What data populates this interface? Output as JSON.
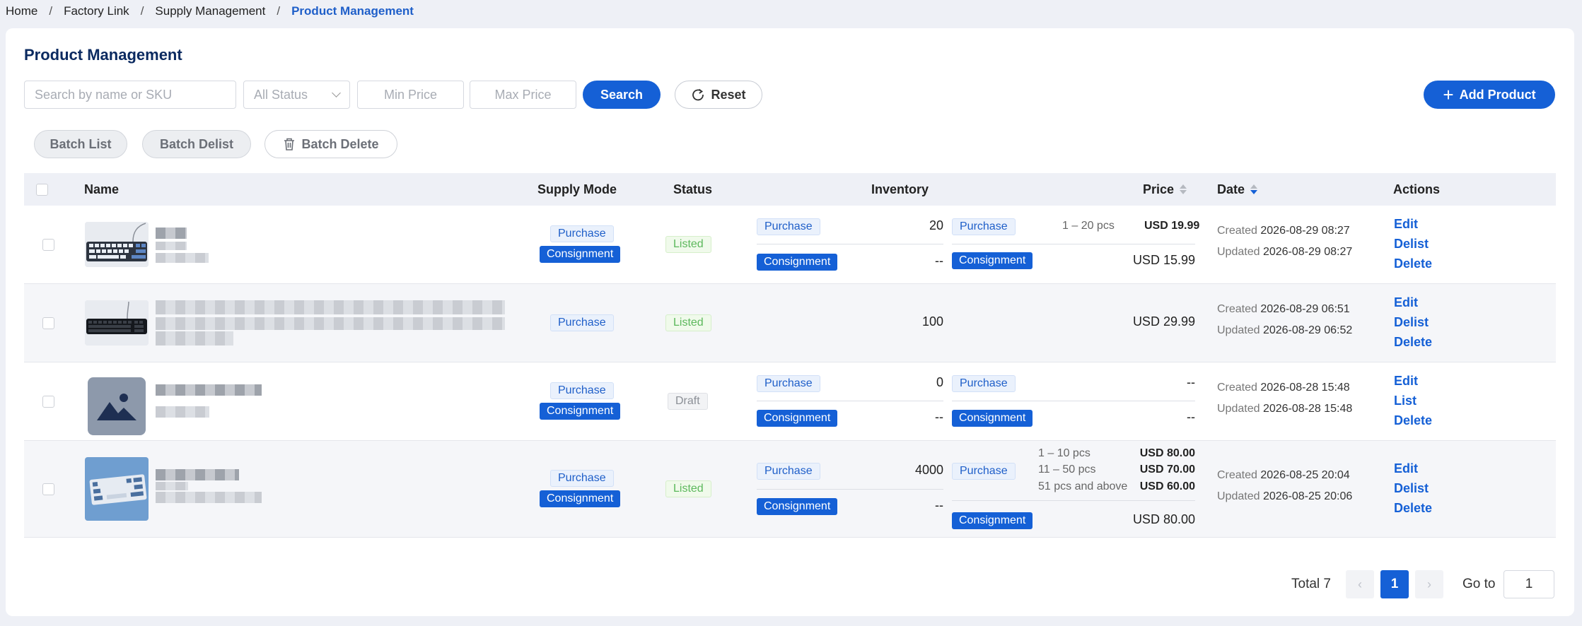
{
  "breadcrumb": [
    "Home",
    "Factory Link",
    "Supply Management",
    "Product Management"
  ],
  "page_title": "Product Management",
  "filters": {
    "search_placeholder": "Search by name or SKU",
    "status_placeholder": "All Status",
    "min_price_placeholder": "Min Price",
    "max_price_placeholder": "Max Price",
    "search_label": "Search",
    "reset_label": "Reset",
    "add_label": "Add Product"
  },
  "batch": {
    "list": "Batch List",
    "delist": "Batch Delist",
    "delete": "Batch Delete"
  },
  "columns": {
    "name": "Name",
    "supply_mode": "Supply Mode",
    "status": "Status",
    "inventory": "Inventory",
    "price": "Price",
    "date": "Date",
    "actions": "Actions"
  },
  "labels": {
    "purchase": "Purchase",
    "consignment": "Consignment",
    "created": "Created",
    "updated": "Updated",
    "edit": "Edit",
    "delete": "Delete"
  },
  "rows": [
    {
      "status": "Listed",
      "inv_purchase": "20",
      "inv_consignment": "--",
      "price_tier": "1 – 20 pcs",
      "price_tier_value": "USD 19.99",
      "price_consignment": "USD 15.99",
      "created": "2026-08-29 08:27",
      "updated": "2026-08-29 08:27",
      "toggle_action": "Delist"
    },
    {
      "status": "Listed",
      "inventory": "100",
      "price": "USD 29.99",
      "created": "2026-08-29 06:51",
      "updated": "2026-08-29 06:52",
      "toggle_action": "Delist"
    },
    {
      "status": "Draft",
      "inv_purchase": "0",
      "inv_consignment": "--",
      "price_purchase": "--",
      "price_consignment": "--",
      "created": "2026-08-28 15:48",
      "updated": "2026-08-28 15:48",
      "toggle_action": "List"
    },
    {
      "status": "Listed",
      "inv_purchase": "4000",
      "inv_consignment": "--",
      "tiers": [
        {
          "range": "1 – 10 pcs",
          "price": "USD 80.00"
        },
        {
          "range": "11 – 50 pcs",
          "price": "USD 70.00"
        },
        {
          "range": "51 pcs and above",
          "price": "USD 60.00"
        }
      ],
      "price_consignment": "USD 80.00",
      "created": "2026-08-25 20:04",
      "updated": "2026-08-25 20:06",
      "toggle_action": "Delist"
    }
  ],
  "pagination": {
    "total_label": "Total 7",
    "current_page": "1",
    "prev_icon": "‹",
    "next_icon": "›",
    "goto_label": "Go to",
    "goto_value": "1"
  },
  "colors": {
    "primary": "#1560d6",
    "listed": "#5cb85c",
    "title": "#0b2a60"
  }
}
